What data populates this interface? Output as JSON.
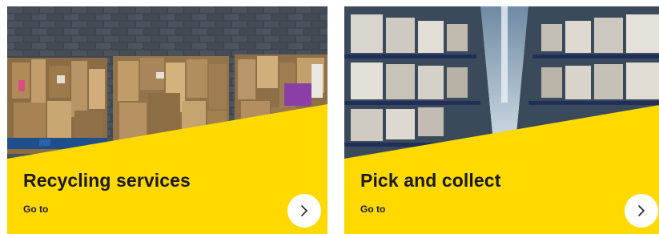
{
  "accent_color": "#FFD900",
  "cards": [
    {
      "title": "Recycling services",
      "link_label": "Go to",
      "image": "baled-cardboard-photo",
      "button_icon": "chevron-right-icon"
    },
    {
      "title": "Pick and collect",
      "link_label": "Go to",
      "image": "warehouse-shelves-photo",
      "button_icon": "chevron-right-icon"
    }
  ]
}
